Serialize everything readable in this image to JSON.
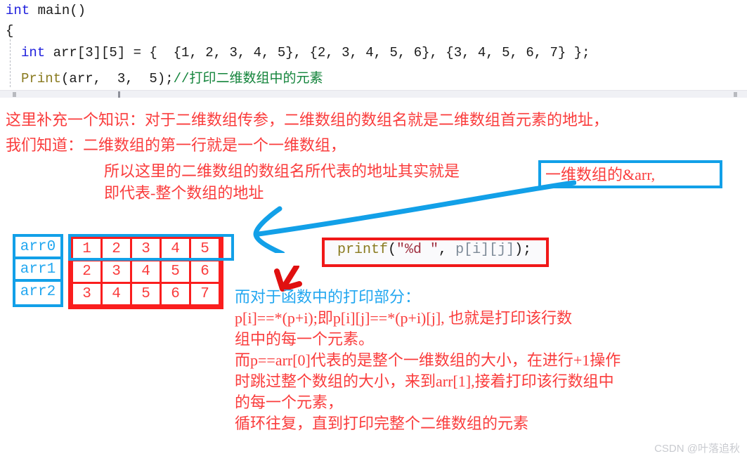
{
  "code": {
    "language": "c",
    "lines": [
      {
        "indent": 0,
        "tokens": [
          {
            "t": "int ",
            "c": "kw"
          },
          {
            "t": "main()",
            "c": "plain"
          }
        ]
      },
      {
        "indent": 0,
        "tokens": [
          {
            "t": "{",
            "c": "plain"
          }
        ]
      },
      {
        "indent": 1,
        "tokens": [
          {
            "t": "int ",
            "c": "kw"
          },
          {
            "t": "arr[3][5] = {  {1, 2, 3, 4, 5}, {2, 3, 4, 5, 6}, {3, 4, 5, 6, 7} };",
            "c": "plain"
          }
        ]
      },
      {
        "indent": 1,
        "tokens": [
          {
            "t": "Print",
            "c": "fn"
          },
          {
            "t": "(arr,  3,  5);",
            "c": "plain"
          },
          {
            "t": "//打印二维数组中的元素",
            "c": "cmt"
          }
        ]
      }
    ]
  },
  "notes": {
    "line_0": "这里补充一个知识：对于二维数组传参，二维数组的数组名就是二维数组首元素的地址，",
    "line_1": "我们知道：二维数组的第一行就是一个一维数组，",
    "line_2": "所以这里的二维数组的数组名所代表的地址其实就是",
    "line_3": "即代表-整个数组的地址",
    "highlight_boxed_text": "一维数组的&arr,"
  },
  "array_diagram": {
    "row_labels": [
      "arr0",
      "arr1",
      "arr2"
    ],
    "rows": [
      [
        1,
        2,
        3,
        4,
        5
      ],
      [
        2,
        3,
        4,
        5,
        6
      ],
      [
        3,
        4,
        5,
        6,
        7
      ]
    ]
  },
  "printf_snippet": {
    "tokens": [
      {
        "t": "printf",
        "c": "pf-name"
      },
      {
        "t": "(",
        "c": "plain"
      },
      {
        "t": "\"%d \"",
        "c": "pf-str"
      },
      {
        "t": ", ",
        "c": "plain"
      },
      {
        "t": "p[i][j]",
        "c": "pf-var"
      },
      {
        "t": ");",
        "c": "plain"
      }
    ]
  },
  "explanation": [
    {
      "text": "而对于函数中的打印部分：",
      "color": "blue"
    },
    {
      "text": "p[i]==*(p+i);即p[i][j]==*(p+i)[j], 也就是打印该行数",
      "color": "red"
    },
    {
      "text": "组中的每一个元素。",
      "color": "red"
    },
    {
      "text": "而p==arr[0]代表的是整个一维数组的大小，在进行+1操作",
      "color": "red"
    },
    {
      "text": "时跳过整个数组的大小，来到arr[1],接着打印该行数组中",
      "color": "red"
    },
    {
      "text": "的每一个元素，",
      "color": "red"
    },
    {
      "text": "循环往复，直到打印完整个二维数组的元素",
      "color": "red"
    }
  ],
  "watermark": "CSDN @叶落追秋",
  "colors": {
    "red": "#fa3c3c",
    "red_border": "#fa1e1e",
    "blue": "#22a7f0",
    "blue_border": "#12a0e8",
    "keyword": "#2222dd",
    "function": "#8a7b20",
    "comment": "#13843b",
    "string": "#a03040",
    "watermark": "#c9cbd0"
  }
}
